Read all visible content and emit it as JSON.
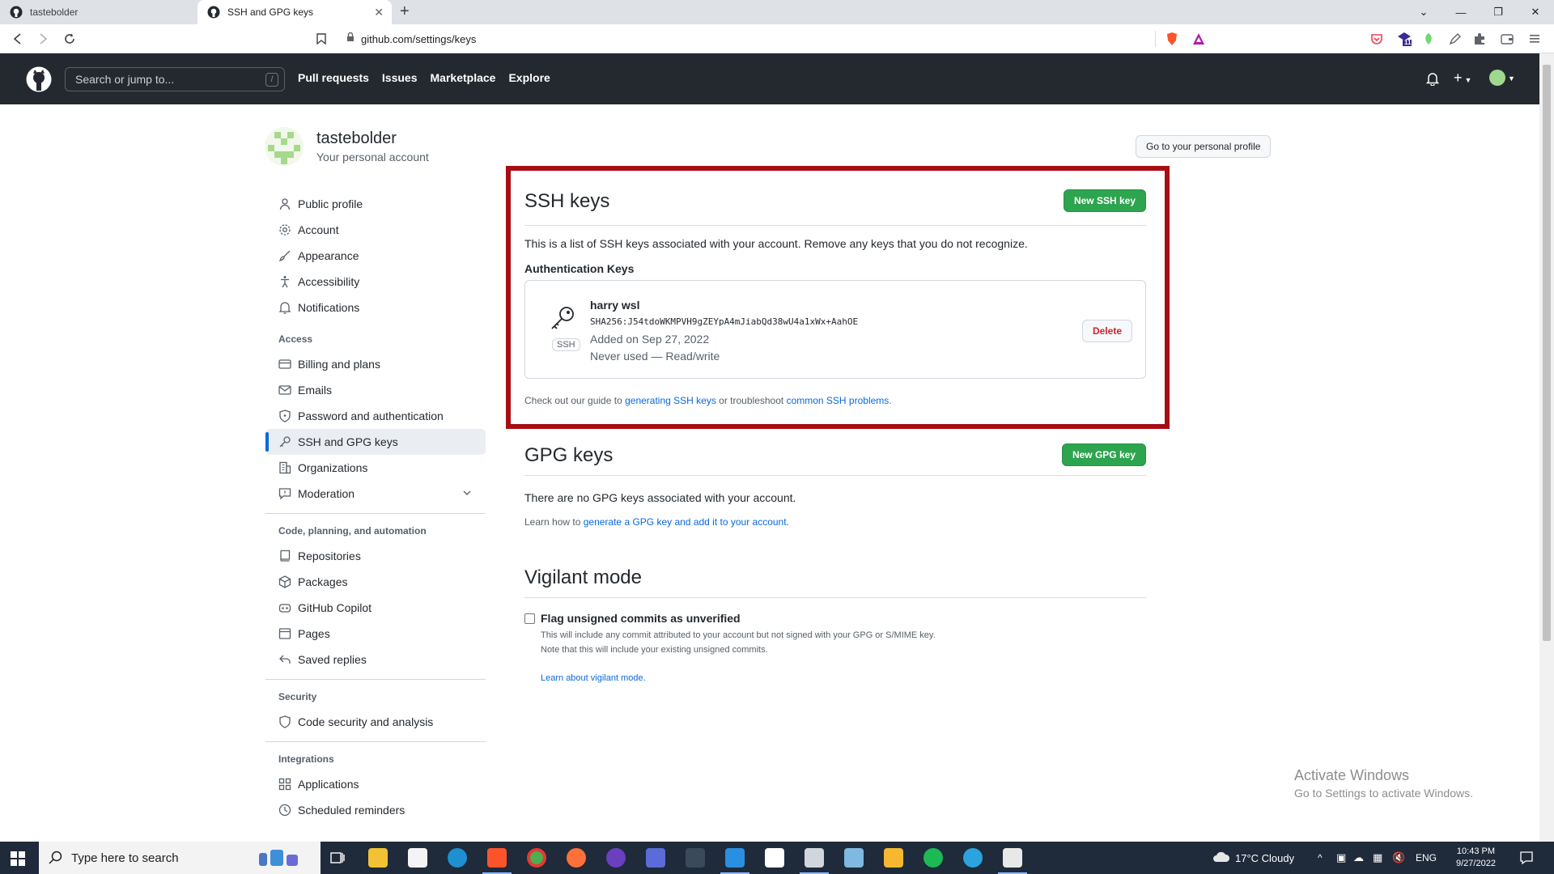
{
  "browser": {
    "tabs": [
      {
        "title": "tastebolder",
        "active": false
      },
      {
        "title": "SSH and GPG keys",
        "active": true
      }
    ],
    "url": "github.com/settings/keys",
    "extension_badge": "11"
  },
  "header": {
    "search_placeholder": "Search or jump to...",
    "search_shortcut": "/",
    "nav": [
      "Pull requests",
      "Issues",
      "Marketplace",
      "Explore"
    ]
  },
  "account": {
    "name": "tastebolder",
    "subtitle": "Your personal account",
    "profile_button": "Go to your personal profile"
  },
  "sidebar": {
    "group1": [
      {
        "label": "Public profile",
        "icon": "person-icon"
      },
      {
        "label": "Account",
        "icon": "gear-icon"
      },
      {
        "label": "Appearance",
        "icon": "paintbrush-icon"
      },
      {
        "label": "Accessibility",
        "icon": "accessibility-icon"
      },
      {
        "label": "Notifications",
        "icon": "bell-icon"
      }
    ],
    "access_heading": "Access",
    "access": [
      {
        "label": "Billing and plans",
        "icon": "credit-card-icon"
      },
      {
        "label": "Emails",
        "icon": "mail-icon"
      },
      {
        "label": "Password and authentication",
        "icon": "shield-lock-icon"
      },
      {
        "label": "SSH and GPG keys",
        "icon": "key-icon",
        "selected": true
      },
      {
        "label": "Organizations",
        "icon": "organization-icon"
      },
      {
        "label": "Moderation",
        "icon": "report-icon"
      }
    ],
    "code_heading": "Code, planning, and automation",
    "code": [
      {
        "label": "Repositories",
        "icon": "repo-icon"
      },
      {
        "label": "Packages",
        "icon": "package-icon"
      },
      {
        "label": "GitHub Copilot",
        "icon": "copilot-icon"
      },
      {
        "label": "Pages",
        "icon": "browser-icon"
      },
      {
        "label": "Saved replies",
        "icon": "reply-icon"
      }
    ],
    "security_heading": "Security",
    "security": [
      {
        "label": "Code security and analysis",
        "icon": "shield-icon"
      }
    ],
    "integrations_heading": "Integrations",
    "integrations": [
      {
        "label": "Applications",
        "icon": "apps-icon"
      },
      {
        "label": "Scheduled reminders",
        "icon": "clock-icon"
      }
    ]
  },
  "ssh": {
    "title": "SSH keys",
    "new_button": "New SSH key",
    "description": "This is a list of SSH keys associated with your account. Remove any keys that you do not recognize.",
    "auth_heading": "Authentication Keys",
    "key": {
      "badge": "SSH",
      "title": "harry wsl",
      "fingerprint": "SHA256:J54tdoWKMPVH9gZEYpA4mJiabQd38wU4a1xWx+AahOE",
      "added": "Added on Sep 27, 2022",
      "usage": "Never used — Read/write",
      "delete_button": "Delete"
    },
    "guide_prefix": "Check out our guide to",
    "guide_link": "generating SSH keys",
    "guide_middle": "or troubleshoot",
    "guide_link2": "common SSH problems",
    "guide_suffix": "."
  },
  "gpg": {
    "title": "GPG keys",
    "new_button": "New GPG key",
    "empty": "There are no GPG keys associated with your account.",
    "learn_prefix": "Learn how to",
    "learn_link": "generate a GPG key and add it to your account",
    "learn_suffix": "."
  },
  "vigilant": {
    "title": "Vigilant mode",
    "checkbox_label": "Flag unsigned commits as unverified",
    "note1": "This will include any commit attributed to your account but not signed with your GPG or S/MIME key.",
    "note2": "Note that this will include your existing unsigned commits.",
    "learn_link": "Learn about vigilant mode."
  },
  "watermark": {
    "line1": "Activate Windows",
    "line2": "Go to Settings to activate Windows."
  },
  "taskbar": {
    "search_placeholder": "Type here to search",
    "weather": "17°C  Cloudy",
    "language": "ENG",
    "time": "10:43 PM",
    "date": "9/27/2022"
  },
  "colors": {
    "github_header": "#24292f",
    "primary_button": "#2da44e",
    "link": "#0969da",
    "danger": "#cf222e",
    "highlight_frame": "#a80d14"
  }
}
